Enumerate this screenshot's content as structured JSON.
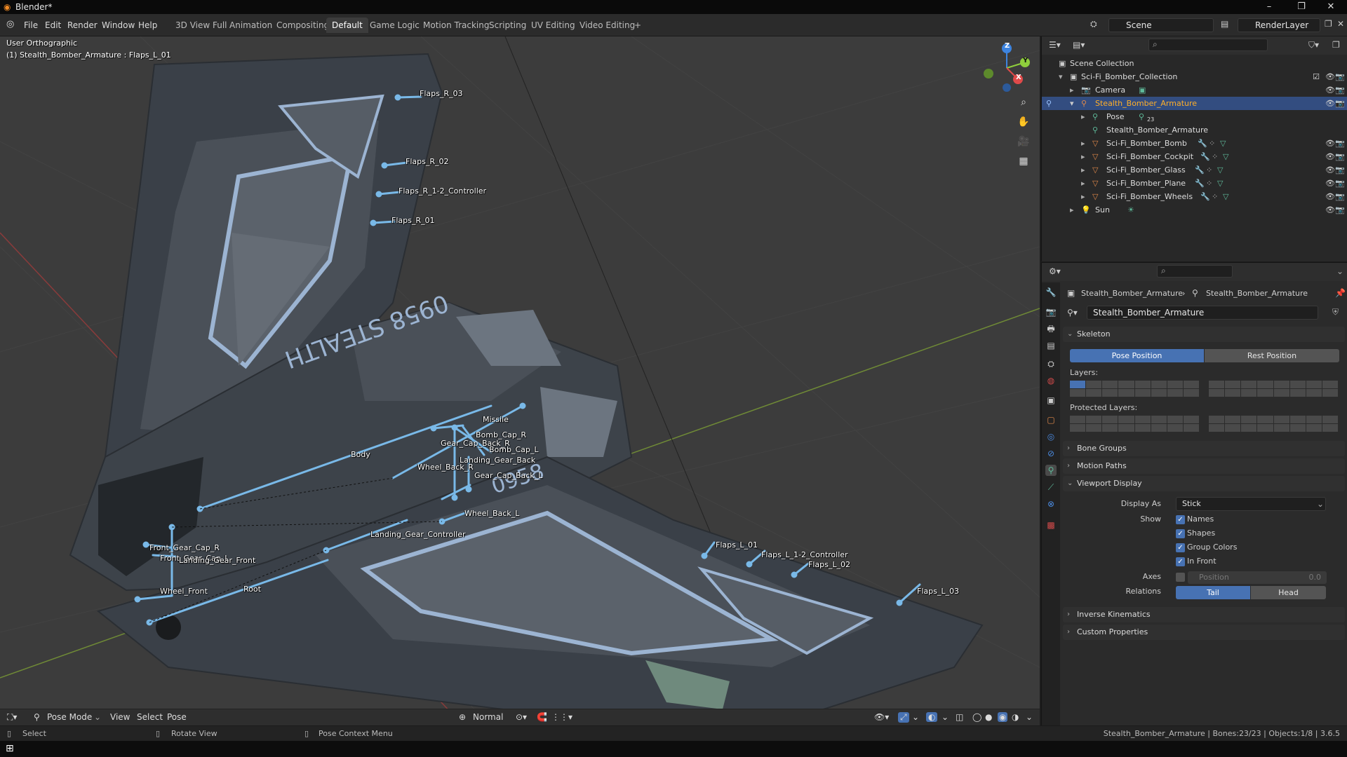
{
  "titlebar": {
    "title": "Blender*",
    "minimize": "–",
    "maximize": "❐",
    "close": "✕"
  },
  "menu": [
    "File",
    "Edit",
    "Render",
    "Window",
    "Help"
  ],
  "workspaces": [
    "3D View Full",
    "Animation",
    "Compositing",
    "Default",
    "Game Logic",
    "Motion Tracking",
    "Scripting",
    "UV Editing",
    "Video Editing",
    "+"
  ],
  "active_workspace": "Default",
  "scene_field": "Scene",
  "renderlayer_field": "RenderLayer",
  "viewport": {
    "view_name": "User Orthographic",
    "active_info": "(1) Stealth_Bomber_Armature : Flaps_L_01",
    "gizmo_axes": {
      "z": "Z",
      "y": "Y",
      "x": "X"
    },
    "axis_colors": {
      "x": "#e04a4a",
      "y": "#8fce3c",
      "z": "#3d84e0"
    },
    "bones": {
      "flaps_r_03": "Flaps_R_03",
      "flaps_r_02": "Flaps_R_02",
      "flaps_r_12": "Flaps_R_1-2_Controller",
      "flaps_r_01": "Flaps_R_01",
      "missile": "Missile",
      "bomb_cap_r": "Bomb_Cap_R",
      "gear_cap_back_r": "Gear_Cap_Back_R",
      "bomb_cap_l": "Bomb_Cap_L",
      "body": "Body",
      "landing_gear_back": "Landing_Gear_Back",
      "wheel_back_r": "Wheel_Back_R",
      "gear_cap_back_l": "Gear_Cap_Back_L",
      "wheel_back_l": "Wheel_Back_L",
      "landing_gear_controller": "Landing_Gear_Controller",
      "front_gear_cap_r": "Front_Gear_Cap_R",
      "front_gear_cap_l": "Front_Gear_Cap_L",
      "landing_gear_front": "Landing_Gear_Front",
      "wheel_front": "Wheel_Front",
      "root": "Root",
      "flaps_l_01": "Flaps_L_01",
      "flaps_l_12": "Flaps_L_1-2_Controller",
      "flaps_l_02": "Flaps_L_02",
      "flaps_l_03": "Flaps_L_03"
    },
    "wing_text_r": "0958 STEALTH",
    "wing_text_l": "0958"
  },
  "vp_header": {
    "mode": "Pose Mode",
    "view": "View",
    "select": "Select",
    "pose": "Pose",
    "transform": "Normal"
  },
  "status": {
    "select": "Select",
    "rotate": "Rotate View",
    "context": "Pose Context Menu",
    "info": "Stealth_Bomber_Armature | Bones:23/23 | Objects:1/8 | 3.6.5"
  },
  "outliner": {
    "rows": [
      {
        "name": "Scene Collection",
        "indent": 0
      },
      {
        "name": "Sci-Fi_Bomber_Collection",
        "indent": 1
      },
      {
        "name": "Camera",
        "indent": 2
      },
      {
        "name": "Stealth_Bomber_Armature",
        "indent": 2
      },
      {
        "name": "Pose",
        "indent": 3
      },
      {
        "name": "Stealth_Bomber_Armature",
        "indent": 3
      },
      {
        "name": "Sci-Fi_Bomber_Bomb",
        "indent": 3
      },
      {
        "name": "Sci-Fi_Bomber_Cockpit",
        "indent": 3
      },
      {
        "name": "Sci-Fi_Bomber_Glass",
        "indent": 3
      },
      {
        "name": "Sci-Fi_Bomber_Plane",
        "indent": 3
      },
      {
        "name": "Sci-Fi_Bomber_Wheels",
        "indent": 3
      },
      {
        "name": "Sun",
        "indent": 2
      }
    ],
    "pose_badge": "23"
  },
  "props": {
    "breadcrumb_1": "Stealth_Bomber_Armature",
    "breadcrumb_2": "Stealth_Bomber_Armature",
    "data_name": "Stealth_Bomber_Armature",
    "skeleton": "Skeleton",
    "pose_position": "Pose Position",
    "rest_position": "Rest Position",
    "layers": "Layers:",
    "protected_layers": "Protected Layers:",
    "bone_groups": "Bone Groups",
    "motion_paths": "Motion Paths",
    "viewport_display": "Viewport Display",
    "display_as_label": "Display As",
    "display_as_value": "Stick",
    "show_label": "Show",
    "names": "Names",
    "shapes": "Shapes",
    "group_colors": "Group Colors",
    "in_front": "In Front",
    "axes_label": "Axes",
    "axes_position": "Position",
    "axes_value": "0.0",
    "relations_label": "Relations",
    "tail": "Tail",
    "head": "Head",
    "inverse_kinematics": "Inverse Kinematics",
    "custom_properties": "Custom Properties"
  }
}
